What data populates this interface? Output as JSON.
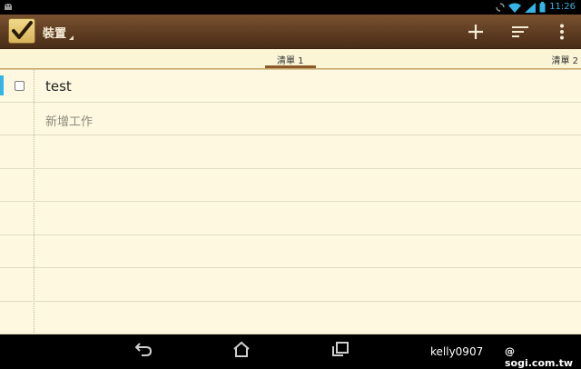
{
  "status_bar": {
    "time": "11:26",
    "icons": [
      "android-icon",
      "sync-icon",
      "wifi-icon",
      "signal-icon",
      "battery-icon"
    ]
  },
  "action_bar": {
    "title": "裝置",
    "app_icon": "checkmark-icon",
    "actions": [
      "add-icon",
      "sort-icon",
      "overflow-menu-icon"
    ]
  },
  "tabs": {
    "active_label": "清單 1",
    "next_label": "清單 2"
  },
  "list": {
    "items": [
      {
        "label": "test",
        "checked": false
      }
    ],
    "new_item_placeholder": "新增工作"
  },
  "nav_bar": {
    "buttons": [
      "back-icon",
      "home-icon",
      "recent-apps-icon"
    ]
  },
  "watermark": {
    "user": "kelly0907",
    "site": "@ sogi.com.tw"
  },
  "colors": {
    "action_bar": "#5b3a20",
    "paper": "#fdf8df",
    "accent": "#33b5e5",
    "tab_indicator": "#8b5a2b"
  }
}
